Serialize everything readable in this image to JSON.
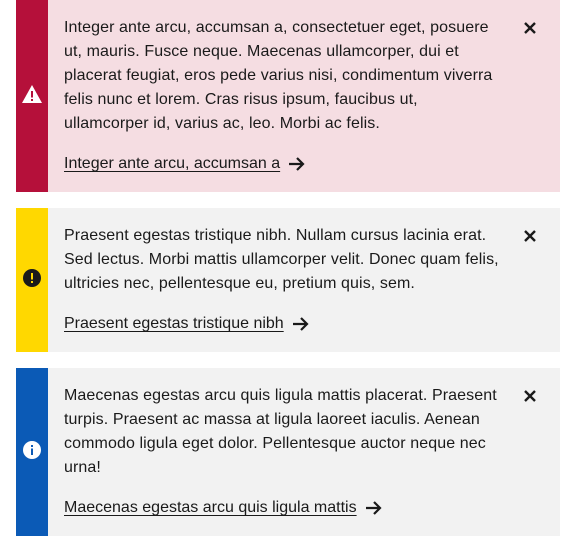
{
  "alerts": [
    {
      "type": "error",
      "icon": "warning-triangle-icon",
      "accent_color": "#b5103a",
      "background": "#f5dde2",
      "message": "Integer ante arcu, accumsan a, consectetuer eget, posuere ut, mauris. Fusce neque. Maecenas ullamcorper, dui et placerat feugiat, eros pede varius nisi, condimentum viverra felis nunc et lorem. Cras risus ipsum, faucibus ut, ullamcorper id, varius ac, leo. Morbi ac felis.",
      "link_label": "Integer ante arcu, accumsan a",
      "close_icon": "close-icon"
    },
    {
      "type": "warning",
      "icon": "exclamation-circle-icon",
      "accent_color": "#ffd800",
      "background": "#f2f2f2",
      "message": "Praesent egestas tristique nibh. Nullam cursus lacinia erat. Sed lectus. Morbi mattis ullamcorper velit. Donec quam felis, ultricies nec, pellentesque eu, pretium quis, sem.",
      "link_label": "Praesent egestas tristique nibh",
      "close_icon": "close-icon"
    },
    {
      "type": "info",
      "icon": "info-circle-icon",
      "accent_color": "#0b5ab6",
      "background": "#f2f2f2",
      "message": "Maecenas egestas arcu quis ligula mattis placerat. Praesent turpis. Praesent ac massa at ligula laoreet iaculis. Aenean commodo ligula eget dolor. Pellentesque auctor neque nec urna!",
      "link_label": "Maecenas egestas arcu quis ligula mattis",
      "close_icon": "close-icon"
    }
  ]
}
